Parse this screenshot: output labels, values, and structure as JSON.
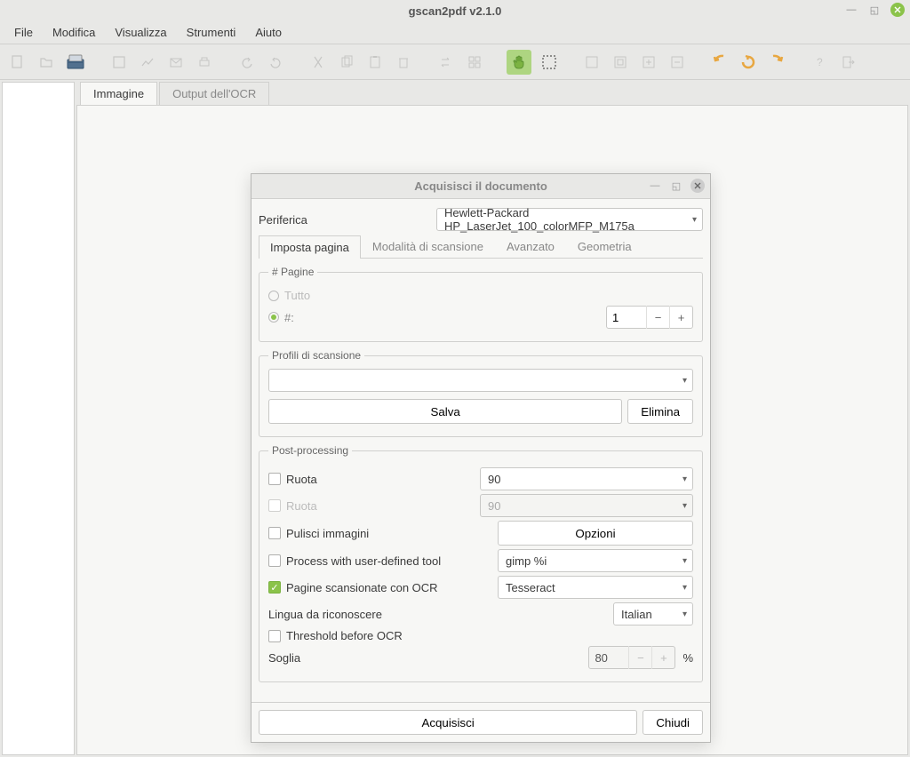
{
  "window": {
    "title": "gscan2pdf v2.1.0"
  },
  "menu": [
    "File",
    "Modifica",
    "Visualizza",
    "Strumenti",
    "Aiuto"
  ],
  "tabs": {
    "image": "Immagine",
    "ocr": "Output dell'OCR"
  },
  "dialog": {
    "title": "Acquisisci il documento",
    "device_label": "Periferica",
    "device_value": "Hewlett-Packard HP_LaserJet_100_colorMFP_M175a",
    "tabs": [
      "Imposta pagina",
      "Modalità di scansione",
      "Avanzato",
      "Geometria"
    ],
    "pages": {
      "legend": "# Pagine",
      "all": "Tutto",
      "hash": "#:",
      "count": "1"
    },
    "profiles": {
      "legend": "Profili di scansione",
      "save": "Salva",
      "delete": "Elimina"
    },
    "post": {
      "legend": "Post-processing",
      "rotate": "Ruota",
      "rotate_val": "90",
      "rotate2": "Ruota",
      "rotate2_val": "90",
      "clean": "Pulisci immagini",
      "options": "Opzioni",
      "udt": "Process with user-defined tool",
      "udt_val": "gimp %i",
      "ocr": "Pagine scansionate con OCR",
      "ocr_engine": "Tesseract",
      "lang_label": "Lingua da riconoscere",
      "lang_val": "Italian",
      "threshold": "Threshold before OCR",
      "soglia": "Soglia",
      "soglia_val": "80",
      "percent": "%"
    },
    "footer": {
      "scan": "Acquisisci",
      "close": "Chiudi"
    }
  }
}
